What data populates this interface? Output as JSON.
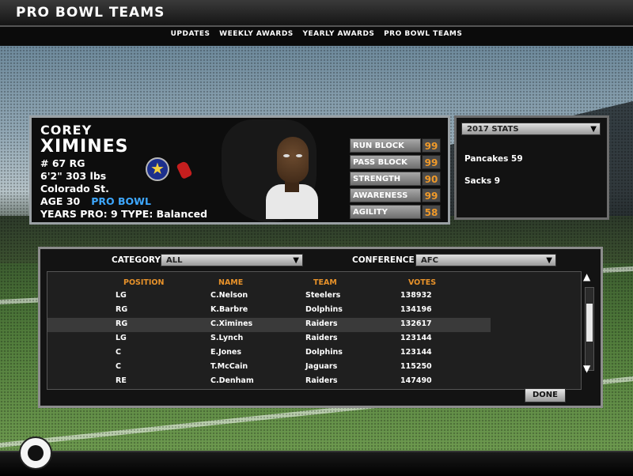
{
  "header": {
    "title": "PRO BOWL TEAMS"
  },
  "nav": [
    "UPDATES",
    "WEEKLY AWARDS",
    "YEARLY AWARDS",
    "PRO BOWL TEAMS"
  ],
  "player": {
    "first_name": "COREY",
    "last_name": "XIMINES",
    "number_pos": "# 67  RG",
    "height_weight": "6'2\"   303 lbs",
    "college": "Colorado St.",
    "age": "AGE   30",
    "pro_bowl": "PRO BOWL",
    "years_type": "YEARS PRO:  9   TYPE: Balanced",
    "ratings": [
      {
        "label": "RUN BLOCK",
        "value": "99"
      },
      {
        "label": "PASS BLOCK",
        "value": "99"
      },
      {
        "label": "STRENGTH",
        "value": "90"
      },
      {
        "label": "AWARENESS",
        "value": "99"
      },
      {
        "label": "AGILITY",
        "value": "58"
      }
    ]
  },
  "stats_panel": {
    "selector": "2017 STATS",
    "stats": [
      "Pancakes  59",
      "Sacks    9"
    ]
  },
  "filters": {
    "category_label": "CATEGORY",
    "category_value": "ALL",
    "conference_label": "CONFERENCE",
    "conference_value": "AFC"
  },
  "table": {
    "headers": [
      "POSITION",
      "NAME",
      "TEAM",
      "VOTES"
    ],
    "rows": [
      [
        "LG",
        "C.Nelson",
        "Steelers",
        "138932"
      ],
      [
        "RG",
        "K.Barbre",
        "Dolphins",
        "134196"
      ],
      [
        "RG",
        "C.Ximines",
        "Raiders",
        "132617"
      ],
      [
        "LG",
        "S.Lynch",
        "Raiders",
        "123144"
      ],
      [
        "C",
        "E.Jones",
        "Dolphins",
        "123144"
      ],
      [
        "C",
        "T.McCain",
        "Jaguars",
        "115250"
      ],
      [
        "RE",
        "C.Denham",
        "Raiders",
        "147490"
      ]
    ],
    "selected_row": 2
  },
  "done_label": "DONE",
  "icons": {
    "dropdown_arrow": "▼",
    "scroll_up": "▲",
    "scroll_down": "▼",
    "star": "★"
  },
  "colors": {
    "accent_orange": "#e8922a",
    "pro_bowl_blue": "#3ea8ff"
  }
}
